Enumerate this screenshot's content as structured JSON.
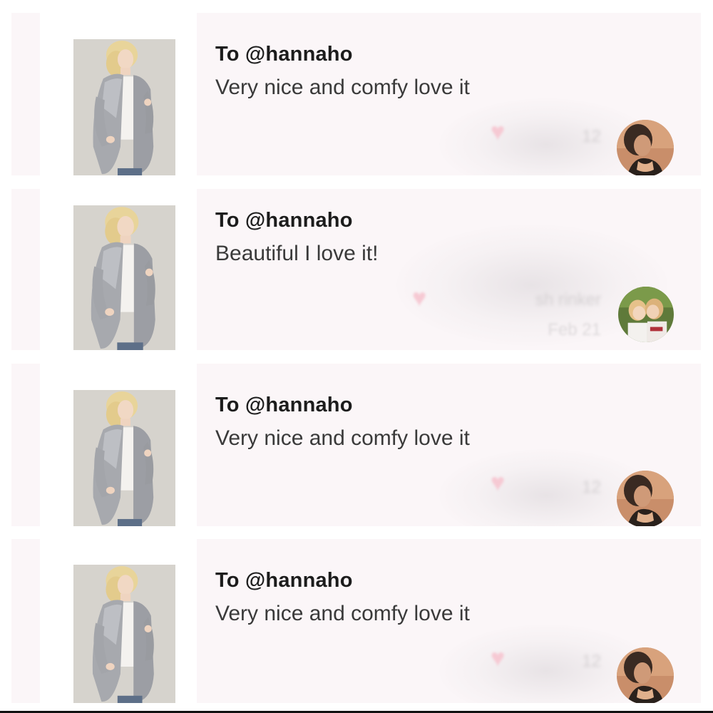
{
  "reviews": [
    {
      "recipient": "To @hannaho",
      "message": "Very nice and comfy love it",
      "reviewer_obscured": "12",
      "date_obscured": ""
    },
    {
      "recipient": "To @hannaho",
      "message": "Beautiful I love it!",
      "reviewer_obscured": "sh      rinker",
      "date_obscured": "Feb 21"
    },
    {
      "recipient": "To @hannaho",
      "message": "Very nice and comfy love it",
      "reviewer_obscured": "12",
      "date_obscured": ""
    },
    {
      "recipient": "To @hannaho",
      "message": "Very nice and comfy love it",
      "reviewer_obscured": "12",
      "date_obscured": ""
    }
  ],
  "icons": {
    "like": "heart-icon",
    "avatar_a": "reviewer-avatar-woman",
    "avatar_b": "reviewer-avatar-children"
  },
  "colors": {
    "card_bg": "#fbf6f8",
    "heart": "#f6c9d3",
    "title": "#1c1c1c",
    "message": "#3a3a3a"
  }
}
